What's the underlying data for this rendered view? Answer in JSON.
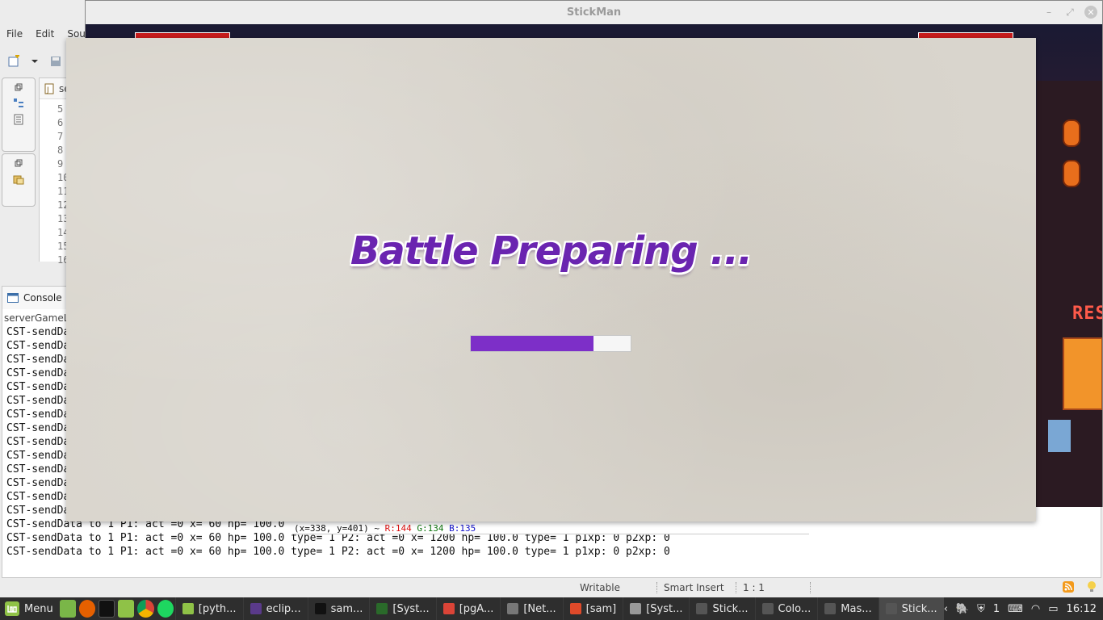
{
  "eclipse": {
    "menu": [
      "File",
      "Edit",
      "Sou"
    ],
    "editor_tab_label": "se",
    "line_numbers": [
      "5",
      "6",
      "7",
      "8",
      "9",
      "10",
      "11",
      "12",
      "13",
      "14",
      "15",
      "16"
    ],
    "console_tab_label": "Console",
    "console_subtitle": "serverGameL",
    "console_lines": [
      "CST-sendDa",
      "CST-sendDa",
      "CST-sendDa",
      "CST-sendDa",
      "CST-sendDa",
      "CST-sendDa",
      "CST-sendDa",
      "CST-sendDa",
      "CST-sendDa",
      "CST-sendDa",
      "CST-sendDa",
      "CST-sendDa",
      "CST-sendDa",
      "CST-sendDa",
      "CST-sendData to 1 P1: act =0 x= 60 hp= 100.0",
      "CST-sendData to 1 P1: act =0 x= 60 hp= 100.0 type= 1 P2: act =0 x= 1200 hp= 100.0 type= 1 p1xp: 0 p2xp: 0",
      "CST-sendData to 1 P1: act =0 x= 60 hp= 100.0 type= 1 P2: act =0 x= 1200 hp= 100.0 type= 1 p1xp: 0 p2xp: 0"
    ],
    "status": {
      "writable": "Writable",
      "insert_mode": "Smart Insert",
      "position": "1 : 1"
    }
  },
  "pixel_tip": {
    "coords": "(x=338, y=401) ~",
    "r": "R:144",
    "g": "G:134",
    "b": "B:135"
  },
  "stickman": {
    "window_title": "StickMan",
    "sign_text": "REST",
    "loading": {
      "title": "Battle Preparing ...",
      "progress": 0.77,
      "progress_color": "#7d2fc8",
      "title_color": "#6a24b0"
    }
  },
  "taskbar": {
    "menu_label": "Menu",
    "tasks": [
      {
        "label": "[pyth...",
        "icon": "folder-icon"
      },
      {
        "label": "eclip...",
        "icon": "eclipse-icon"
      },
      {
        "label": "sam...",
        "icon": "terminal-icon"
      },
      {
        "label": "[Syst...",
        "icon": "system-monitor-icon"
      },
      {
        "label": "[pgA...",
        "icon": "chrome-icon"
      },
      {
        "label": "[Net...",
        "icon": "network-icon"
      },
      {
        "label": "[sam]",
        "icon": "git-icon"
      },
      {
        "label": "[Syst...",
        "icon": "settings-icon"
      },
      {
        "label": "Stick...",
        "icon": "window-icon"
      },
      {
        "label": "Colo...",
        "icon": "window-icon"
      },
      {
        "label": "Mas...",
        "icon": "window-icon"
      },
      {
        "label": "Stick...",
        "icon": "window-icon",
        "active": true
      }
    ],
    "tray": {
      "notifications": "1",
      "clock": "16:12"
    }
  }
}
